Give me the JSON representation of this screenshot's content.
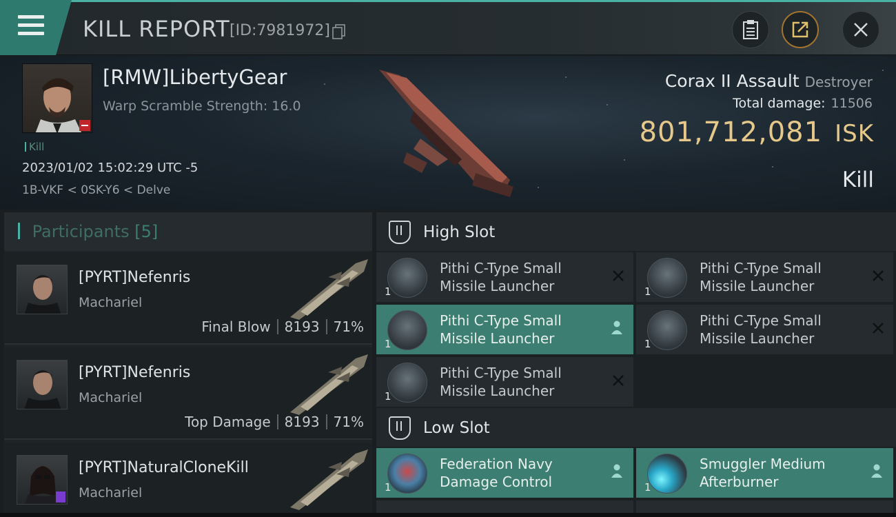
{
  "header": {
    "title": "KILL REPORT",
    "id_text": "[ID:7981972]"
  },
  "victim": {
    "name": "[RMW]LibertyGear",
    "warp_scramble": "Warp Scramble Strength: 16.0",
    "tag": "Kill",
    "datetime": "2023/01/02 15:02:29 UTC -5",
    "location": "1B-VKF < 0SK-Y6 < Delve",
    "ship": "Corax II Assault",
    "ship_class": "Destroyer",
    "total_damage_label": "Total damage:",
    "total_damage": "11506",
    "isk_value": "801,712,081",
    "isk_unit": "ISK",
    "result": "Kill"
  },
  "participants": {
    "title": "Participants",
    "count": "[5]",
    "items": [
      {
        "name": "[PYRT]Nefenris",
        "ship": "Machariel",
        "role": "Final Blow",
        "damage": "8193",
        "percent": "71%"
      },
      {
        "name": "[PYRT]Nefenris",
        "ship": "Machariel",
        "role": "Top Damage",
        "damage": "8193",
        "percent": "71%"
      },
      {
        "name": "[PYRT]NaturalCloneKill",
        "ship": "Machariel"
      }
    ]
  },
  "fitting": {
    "high_slot": "High Slot",
    "low_slot": "Low Slot",
    "high_modules": [
      {
        "name": "Pithi C-Type Small Missile Launcher",
        "qty": "1",
        "status": "destroyed"
      },
      {
        "name": "Pithi C-Type Small Missile Launcher",
        "qty": "1",
        "status": "destroyed"
      },
      {
        "name": "Pithi C-Type Small Missile Launcher",
        "qty": "1",
        "status": "dropped"
      },
      {
        "name": "Pithi C-Type Small Missile Launcher",
        "qty": "1",
        "status": "destroyed"
      },
      {
        "name": "Pithi C-Type Small Missile Launcher",
        "qty": "1",
        "status": "destroyed"
      }
    ],
    "low_modules": [
      {
        "name": "Federation Navy Damage Control",
        "qty": "1",
        "status": "dropped"
      },
      {
        "name": "Smuggler Medium Afterburner",
        "qty": "1",
        "status": "dropped"
      }
    ]
  },
  "colors": {
    "accent": "#49b2a3",
    "highlight_row": "#3d7e72",
    "isk": "#e6c98a",
    "alert_badge": "#c0262b"
  },
  "icons": [
    "menu-icon",
    "copy-icon",
    "clipboard-icon",
    "share-icon",
    "close-icon",
    "slot-icon",
    "destroyed-x-icon",
    "pilot-icon"
  ]
}
